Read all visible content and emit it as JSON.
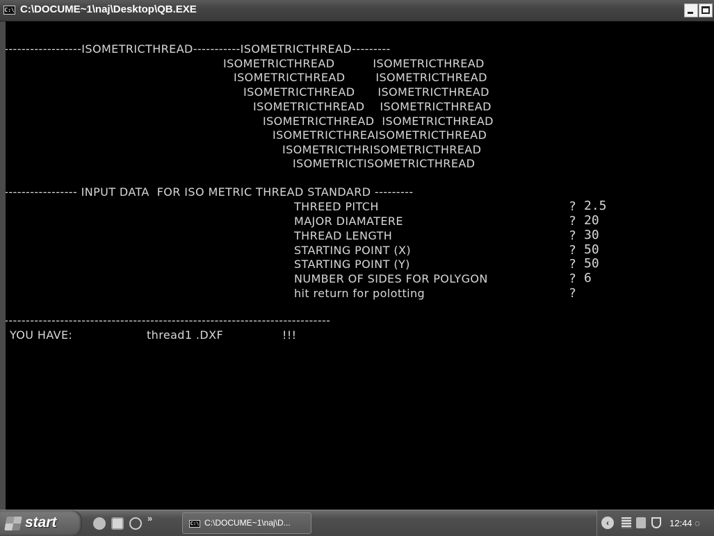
{
  "window": {
    "title": "C:\\DOCUME~1\\naj\\Desktop\\QB.EXE",
    "icon_label": "C:\\"
  },
  "console": {
    "banner_lines": [
      "-------------------ISOMETRICTHREAD-----------ISOMETRICTHREAD---------",
      "ISOMETRICTHREAD          ISOMETRICTHREAD",
      "ISOMETRICTHREAD        ISOMETRICTHREAD",
      "ISOMETRICTHREAD      ISOMETRICTHREAD",
      "ISOMETRICTHREAD    ISOMETRICTHREAD",
      "ISOMETRICTHREAD  ISOMETRICTHREAD",
      "ISOMETRICTHREAISOMETRICTHREAD",
      "ISOMETRICTHRISOMETRICTHREAD",
      "ISOMETRICTISOMETRICTHREAD"
    ],
    "input_header": "------------------ INPUT DATA  FOR ISO METRIC THREAD STANDARD ---------",
    "inputs": [
      {
        "label": "THREED PITCH",
        "prompt": "?",
        "value": "2.5"
      },
      {
        "label": "MAJOR DIAMATERE",
        "prompt": "?",
        "value": "20"
      },
      {
        "label": "THREAD LENGTH",
        "prompt": "?",
        "value": "30"
      },
      {
        "label": "STARTING POINT (X)",
        "prompt": "?",
        "value": "50"
      },
      {
        "label": "STARTING POINT (Y)",
        "prompt": "?",
        "value": "50"
      },
      {
        "label": "NUMBER OF SIDES FOR POLYGON",
        "prompt": "?",
        "value": "6"
      },
      {
        "label": "hit return for polotting",
        "prompt": "?",
        "value": ""
      }
    ],
    "separator": "-----------------------------------------------------------------------------",
    "result_label": "YOU HAVE:",
    "result_file": "thread1 .DXF",
    "result_suffix": "!!!"
  },
  "taskbar": {
    "start_label": "start",
    "quicklaunch_chevron": "»",
    "task_label": "C:\\DOCUME~1\\naj\\D...",
    "task_icon_label": "C:\\",
    "tray_arrow": "‹",
    "clock": "12:44 ◌"
  },
  "colors": {
    "console_bg": "#000000",
    "console_fg": "#d8d8d8",
    "titlebar": "#444444",
    "taskbar": "#4f4f4f"
  }
}
